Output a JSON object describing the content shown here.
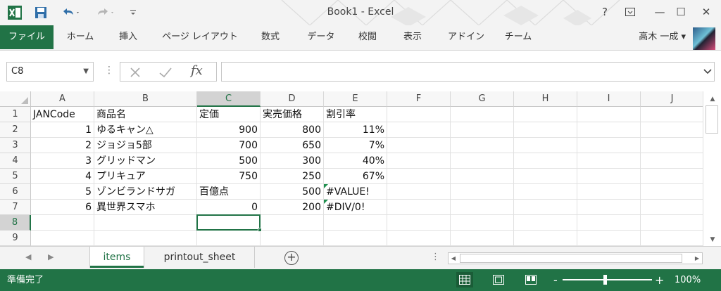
{
  "window": {
    "title": "Book1 - Excel",
    "help": "?",
    "minimize": "—",
    "maximize": "☐",
    "close": "✕"
  },
  "ribbon": {
    "file": "ファイル",
    "tabs": [
      "ホーム",
      "挿入",
      "ページ レイアウト",
      "数式",
      "データ",
      "校閲",
      "表示",
      "アドイン",
      "チーム"
    ],
    "user": "高木 一成"
  },
  "formula_bar": {
    "name_box": "C8",
    "fx": "fx",
    "value": ""
  },
  "grid": {
    "columns": [
      "A",
      "B",
      "C",
      "D",
      "E",
      "F",
      "G",
      "H",
      "I",
      "J"
    ],
    "rows": [
      "1",
      "2",
      "3",
      "4",
      "5",
      "6",
      "7",
      "8",
      "9"
    ],
    "active_cell": "C8",
    "cells": [
      [
        "JANCode",
        "商品名",
        "定価",
        "実売価格",
        "割引率"
      ],
      [
        "1",
        "ゆるキャン△",
        "900",
        "800",
        "11%"
      ],
      [
        "2",
        "ジョジョ5部",
        "700",
        "650",
        "7%"
      ],
      [
        "3",
        "グリッドマン",
        "500",
        "300",
        "40%"
      ],
      [
        "4",
        "プリキュア",
        "750",
        "250",
        "67%"
      ],
      [
        "5",
        "ゾンビランドサガ",
        "百億点",
        "500",
        "#VALUE!"
      ],
      [
        "6",
        "異世界スマホ",
        "0",
        "200",
        "#DIV/0!"
      ]
    ]
  },
  "sheets": {
    "tabs": [
      "items",
      "printout_sheet"
    ],
    "active": "items",
    "add": "+"
  },
  "status_bar": {
    "ready": "準備完了",
    "zoom": "100%",
    "zoom_minus": "-",
    "zoom_plus": "+"
  },
  "colors": {
    "accent": "#217346",
    "error_marker": "#1f8f4e"
  }
}
